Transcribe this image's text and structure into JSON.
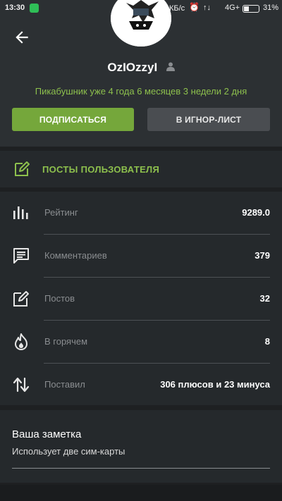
{
  "status_bar": {
    "time": "13:30",
    "speed": "КБ/с",
    "network": "4G+",
    "battery": "31%"
  },
  "profile": {
    "username": "OzIOzzyI",
    "tenure": "Пикабушник уже 4 года 6 месяцев 3 недели 2 дня"
  },
  "actions": {
    "subscribe_label": "ПОДПИСАТЬСЯ",
    "ignore_label": "В ИГНОР-ЛИСТ"
  },
  "posts_link": {
    "label": "ПОСТЫ ПОЛЬЗОВАТЕЛЯ"
  },
  "stats": [
    {
      "label": "Рейтинг",
      "value": "9289.0",
      "icon": "bar-chart-icon"
    },
    {
      "label": "Комментариев",
      "value": "379",
      "icon": "comment-icon"
    },
    {
      "label": "Постов",
      "value": "32",
      "icon": "edit-icon"
    },
    {
      "label": "В горячем",
      "value": "8",
      "icon": "flame-icon"
    },
    {
      "label": "Поставил",
      "value": "306 плюсов и 23 минуса",
      "icon": "vote-arrows-icon"
    }
  ],
  "note": {
    "title": "Ваша заметка",
    "text": "Использует две сим-карты"
  },
  "colors": {
    "accent_green": "#75a73b",
    "text_green": "#8dc04d",
    "header_bg": "#2c3033",
    "card_bg": "#25292c"
  }
}
